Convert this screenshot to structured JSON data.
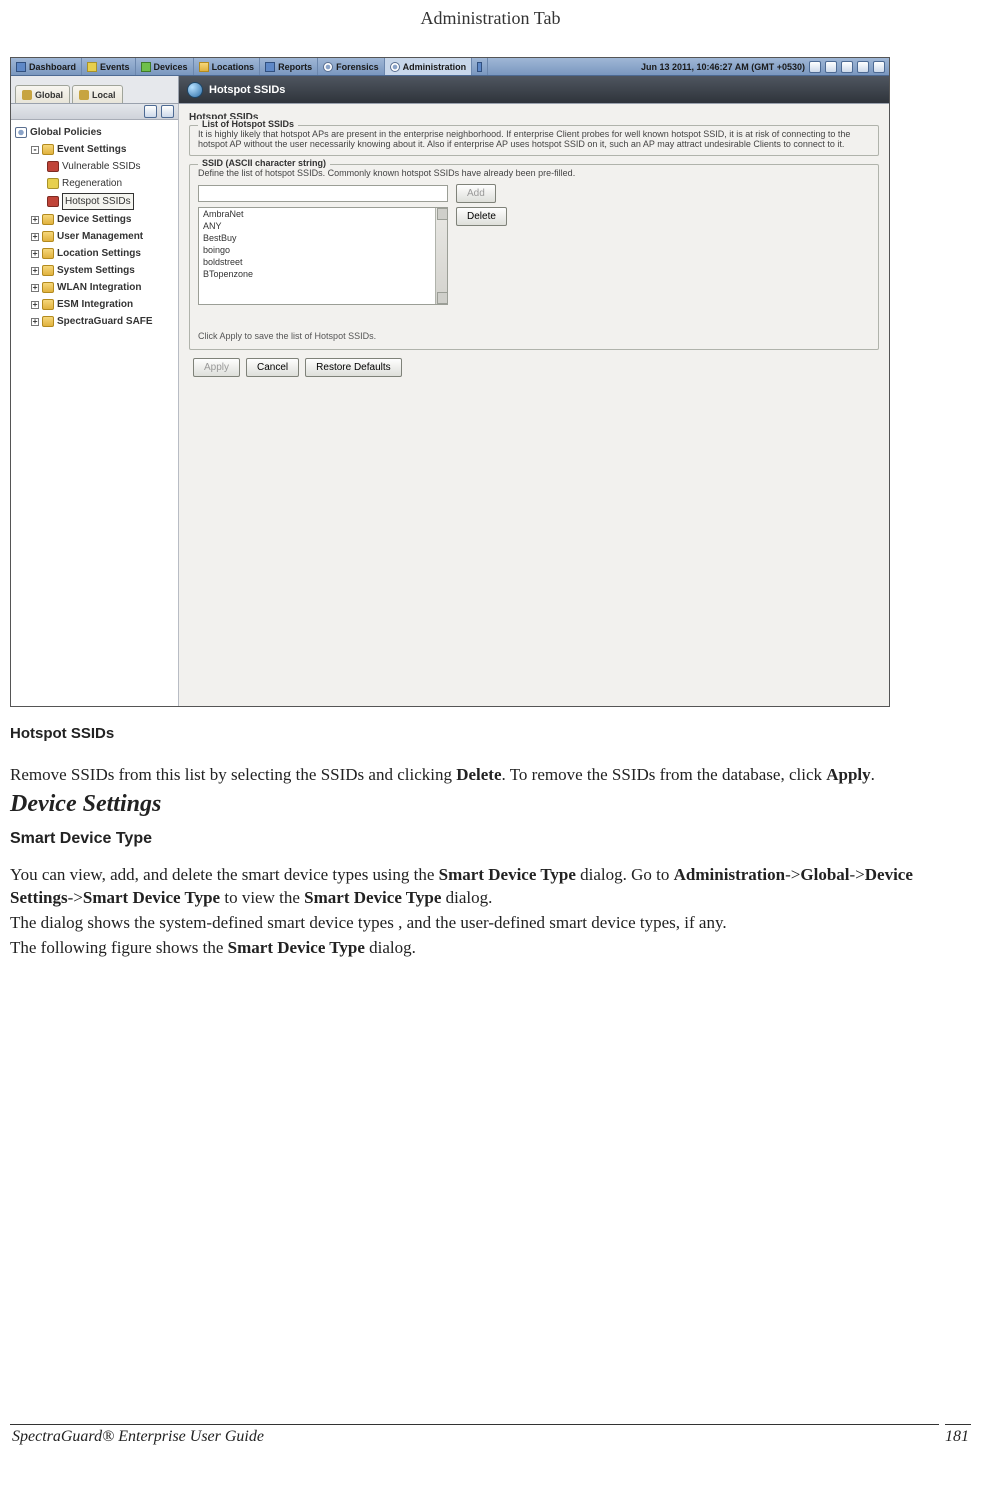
{
  "page": {
    "header_title": "Administration Tab",
    "footer_title": "SpectraGuard® Enterprise User Guide",
    "page_number": "181"
  },
  "screenshot": {
    "top_tabs": [
      "Dashboard",
      "Events",
      "Devices",
      "Locations",
      "Reports",
      "Forensics",
      "Administration"
    ],
    "active_top_tab": 6,
    "timestamp": "Jun 13 2011, 10:46:27 AM (GMT +0530)",
    "global_tabs": [
      "Global",
      "Local"
    ],
    "panel_title": "Hotspot SSIDs",
    "tree": {
      "root": "Global Policies",
      "nodes": [
        {
          "label": "Event Settings",
          "expanded": true,
          "children": [
            {
              "label": "Vulnerable SSIDs"
            },
            {
              "label": "Regeneration"
            },
            {
              "label": "Hotspot SSIDs",
              "selected": true
            }
          ]
        },
        {
          "label": "Device Settings"
        },
        {
          "label": "User Management"
        },
        {
          "label": "Location Settings"
        },
        {
          "label": "System Settings"
        },
        {
          "label": "WLAN Integration"
        },
        {
          "label": "ESM Integration"
        },
        {
          "label": "SpectraGuard SAFE"
        }
      ]
    },
    "main": {
      "title": "Hotspot SSIDs",
      "list_group_legend": "List of Hotspot SSIDs",
      "list_group_text": "It is highly likely that hotspot APs are present in the enterprise neighborhood. If enterprise Client probes for well known hotspot SSID, it is at risk of connecting to the hotspot AP without the user necessarily knowing about it. Also if enterprise AP uses hotspot SSID on it, such an AP may attract undesirable Clients to connect to it.",
      "ssid_group_legend": "SSID (ASCII character string)",
      "ssid_group_text": "Define the list of hotspot SSIDs. Commonly known hotspot SSIDs have already been pre-filled.",
      "add_button": "Add",
      "delete_button": "Delete",
      "ssids": [
        "AmbraNet",
        "ANY",
        "BestBuy",
        "boingo",
        "boldstreet",
        "BTopenzone"
      ],
      "hint": "Click Apply to save the list of Hotspot SSIDs.",
      "apply_button": "Apply",
      "cancel_button": "Cancel",
      "restore_button": "Restore Defaults"
    }
  },
  "doc": {
    "caption": "Hotspot SSIDs",
    "para1_a": "Remove SSIDs from this list by selecting the SSIDs and clicking ",
    "para1_b": "Delete",
    "para1_c": ". To remove the SSIDs from the database, click ",
    "para1_d": "Apply",
    "para1_e": ".",
    "h2": "Device Settings",
    "h3": "Smart Device Type",
    "para2_a": "You can view, add, and delete the smart device types using the ",
    "para2_b": "Smart Device Type",
    "para2_c": " dialog. Go to ",
    "para2_d": "Administration",
    "para2_sep": "->",
    "para2_e": "Global",
    "para2_f": "Device Settings",
    "para2_g": "Smart Device Type",
    "para2_h": " to view the ",
    "para2_i": "Smart Device Type",
    "para2_j": " dialog.",
    "para3": "The dialog shows the system-defined smart device types , and the user-defined smart device types, if any.",
    "para4_a": "The following figure shows the ",
    "para4_b": "Smart Device Type",
    "para4_c": " dialog."
  }
}
